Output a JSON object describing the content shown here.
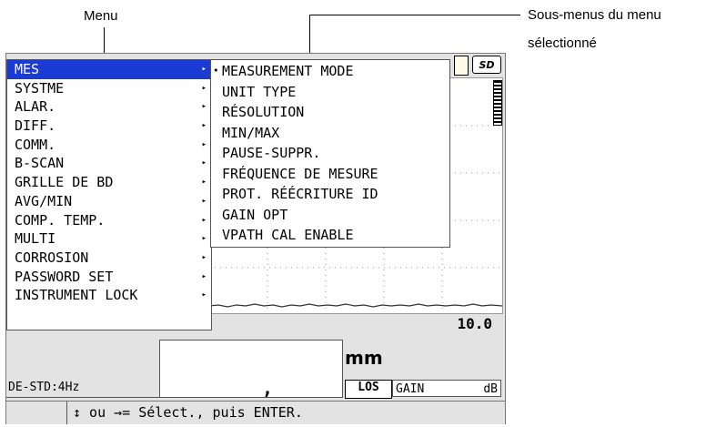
{
  "annotations": {
    "menu_label": "Menu",
    "submenu_label_line1": "Sous-menus du menu",
    "submenu_label_line2": "sélectionné"
  },
  "main_menu": {
    "items": [
      {
        "label": "MES",
        "selected": true
      },
      {
        "label": "SYSTME",
        "selected": false
      },
      {
        "label": "ALAR.",
        "selected": false
      },
      {
        "label": "DIFF.",
        "selected": false
      },
      {
        "label": "COMM.",
        "selected": false
      },
      {
        "label": "B-SCAN",
        "selected": false
      },
      {
        "label": "GRILLE DE BD",
        "selected": false
      },
      {
        "label": "AVG/MIN",
        "selected": false
      },
      {
        "label": "COMP. TEMP.",
        "selected": false
      },
      {
        "label": "MULTI",
        "selected": false
      },
      {
        "label": "CORROSION",
        "selected": false
      },
      {
        "label": "PASSWORD SET",
        "selected": false
      },
      {
        "label": "INSTRUMENT LOCK",
        "selected": false
      }
    ],
    "arrow": "▸"
  },
  "sub_menu": {
    "bullet": "•",
    "items": [
      {
        "label": "MEASUREMENT MODE",
        "current": true
      },
      {
        "label": "UNIT TYPE",
        "current": false
      },
      {
        "label": "RÉSOLUTION",
        "current": false
      },
      {
        "label": "MIN/MAX",
        "current": false
      },
      {
        "label": "PAUSE-SUPPR.",
        "current": false
      },
      {
        "label": "FRÉQUENCE DE MESURE",
        "current": false
      },
      {
        "label": "PROT. RÉÉCRITURE ID",
        "current": false
      },
      {
        "label": "GAIN OPT",
        "current": false
      },
      {
        "label": "VPATH CAL ENABLE",
        "current": false
      }
    ]
  },
  "status": {
    "sd_label": "SD"
  },
  "display": {
    "range_value": "10.0",
    "reading_value": ",",
    "unit": "mm",
    "probe": "DE-STD:4Hz",
    "los": "LOS",
    "gain_label": "GAIN",
    "gain_unit": "dB"
  },
  "help": {
    "text": "↕ ou →= Sélect., puis ENTER."
  },
  "colors": {
    "selection": "#1a3bd4",
    "screen_bg": "#e3e3e3"
  }
}
